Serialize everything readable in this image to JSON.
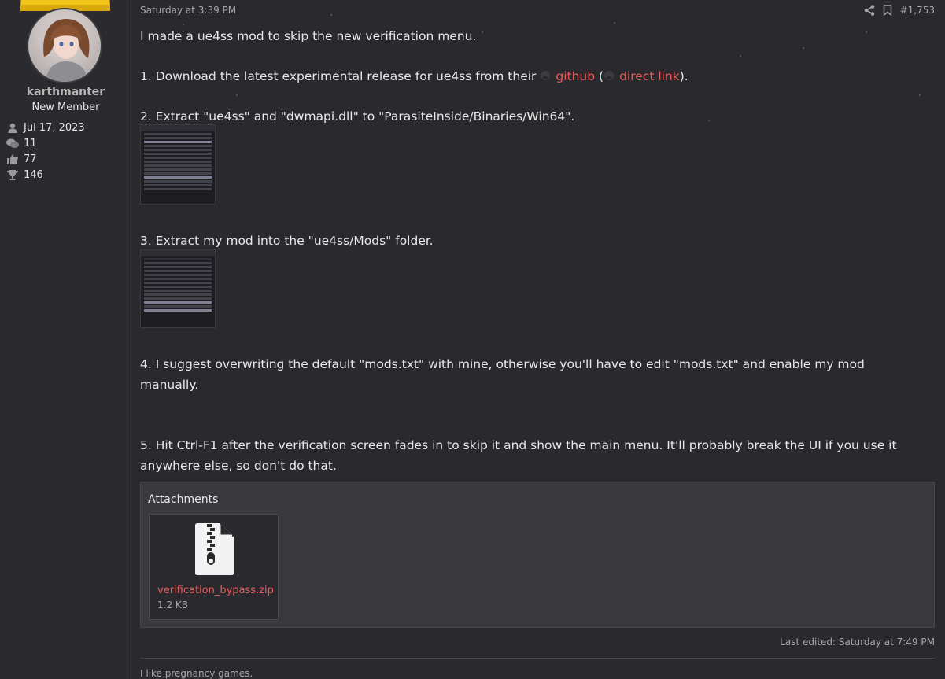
{
  "user": {
    "name": "karthmanter",
    "title": "New Member",
    "stats": [
      {
        "icon": "user-icon",
        "value": "Jul 17, 2023"
      },
      {
        "icon": "messages-icon",
        "value": "11"
      },
      {
        "icon": "thumbs-up-icon",
        "value": "77"
      },
      {
        "icon": "trophy-icon",
        "value": "146"
      }
    ]
  },
  "post": {
    "date": "Saturday at 3:39 PM",
    "post_number": "#1,753",
    "line1": "I made a ue4ss mod to skip the new verification menu.",
    "step1_prefix": "1. Download the latest experimental release for ue4ss from their",
    "step1_link1": "github",
    "step1_mid": "(",
    "step1_link2": "direct link",
    "step1_suffix": ").",
    "step2": "2. Extract \"ue4ss\" and \"dwmapi.dll\" to \"ParasiteInside/Binaries/Win64\".",
    "step3": "3. Extract my mod into the \"ue4ss/Mods\" folder.",
    "step4": "4. I suggest overwriting the default \"mods.txt\" with mine, otherwise you'll have to edit \"mods.txt\" and enable my mod manually.",
    "step5": "5. Hit Ctrl-F1 after the verification screen fades in to skip it and show the main menu. It'll probably break the UI if you use it anywhere else, so don't do that.",
    "attachments_title": "Attachments",
    "attachment": {
      "name": "verification_bypass.zip",
      "size": "1.2 KB",
      "icon": "zip-file-icon"
    },
    "last_edited": "Last edited: Saturday at 7:49 PM",
    "signature": "I like pregnancy games."
  },
  "colors": {
    "link": "#e85a5a",
    "background": "#2a2a2e",
    "panel": "#3a3a3e"
  }
}
